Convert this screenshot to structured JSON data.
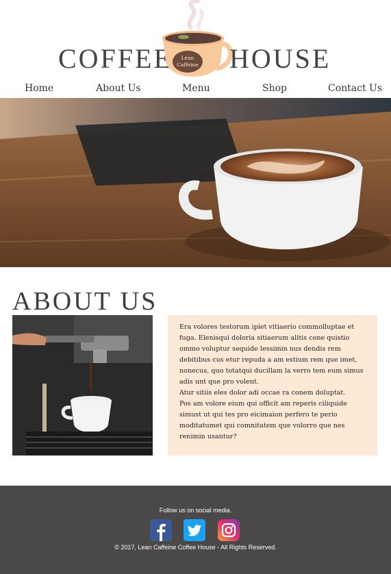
{
  "brand": {
    "word_left": "COFFEE",
    "word_right": "HOUSE",
    "badge_line1": "Lean",
    "badge_line2": "Caffeine"
  },
  "nav": {
    "items": [
      {
        "label": "Home"
      },
      {
        "label": "About Us"
      },
      {
        "label": "Menu"
      },
      {
        "label": "Shop"
      },
      {
        "label": "Contact Us"
      }
    ]
  },
  "about": {
    "title": "ABOUT US",
    "paragraphs": [
      "Era volores testorum ipiet vitiaerio commolluptae et fuga. Elenisqui doloria sitiaerum alitis cone quistio ommo voluptur sequide lessimin nus dendis rem debitibus cus etur repuda a am estium rem que imet, nonecus, quo totatqui ducillam la verro tem eum simus adis unt que pro volent.",
      "Atur sitiis eles dolor adi occae ra conem doluptat.",
      "Pos am volore eium qui officit am reperis ciliquide simust ut qui tes pro eicimaion perfero te perio moditatumet qui comnitatem que volorro que nes renimin usantur?"
    ]
  },
  "footer": {
    "follow": "Follow us on social media.",
    "social": [
      {
        "icon": "facebook-icon"
      },
      {
        "icon": "twitter-icon"
      },
      {
        "icon": "instagram-icon"
      }
    ],
    "copyright": "© 2017, Lean Caffeine Coffee House - All Rights Reserved."
  },
  "colors": {
    "about_box": "#fde9d6",
    "footer": "#4a4948",
    "facebook": "#3b5998",
    "twitter": "#1da1f2",
    "instagram": "#c13584"
  }
}
